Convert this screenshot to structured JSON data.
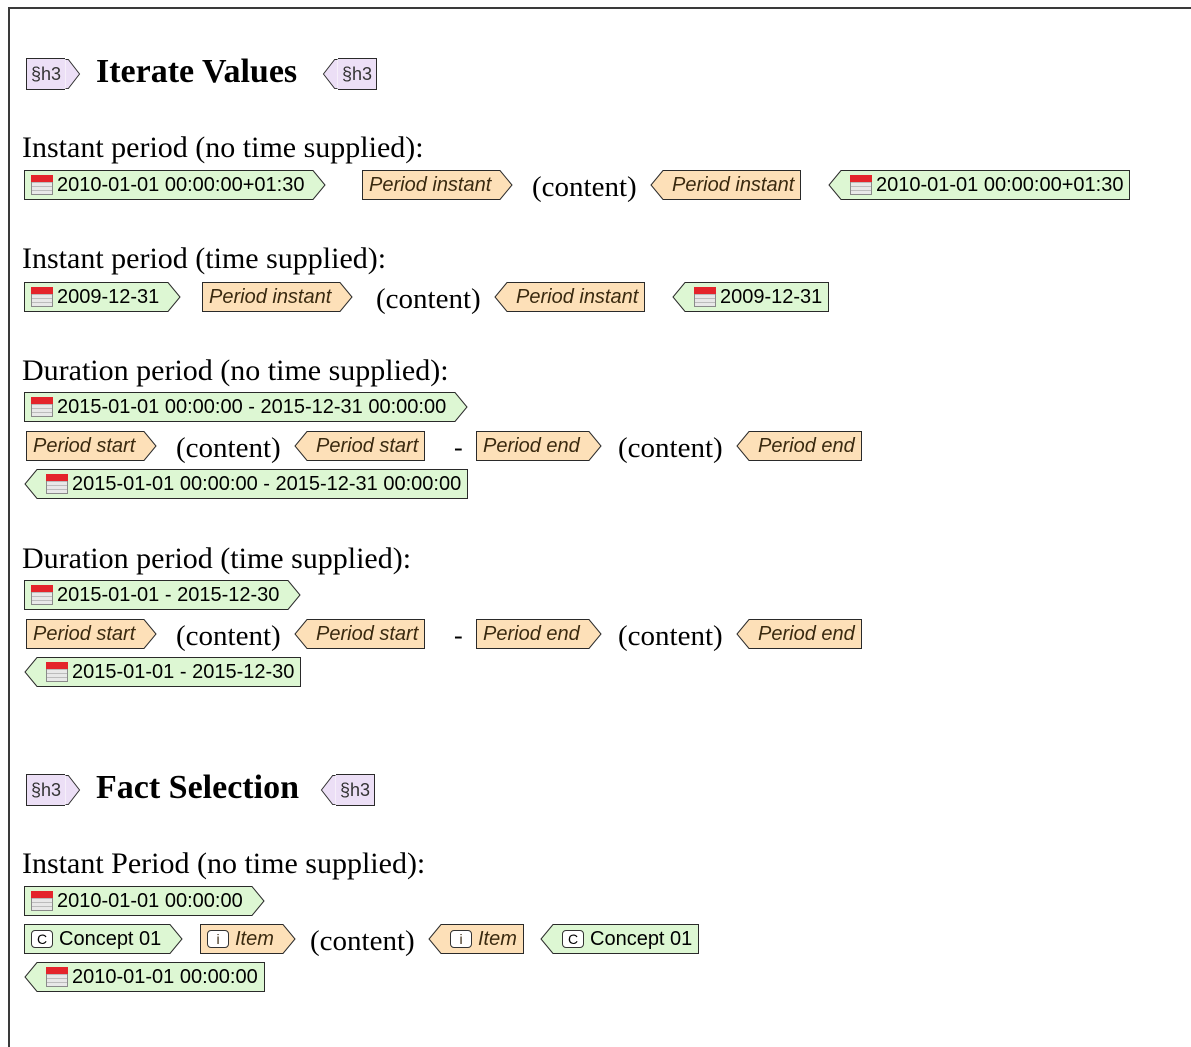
{
  "tag_h3": "§h3",
  "section1": {
    "title": "Iterate Values",
    "instant_no_time": {
      "label": "Instant period (no time supplied):",
      "date": "2010-01-01 00:00:00+01:30",
      "period_tag": "Period instant",
      "content": "(content)"
    },
    "instant_time": {
      "label": "Instant period (time supplied):",
      "date": "2009-12-31",
      "period_tag": "Period instant",
      "content": "(content)"
    },
    "duration_no_time": {
      "label": "Duration period (no time supplied):",
      "date": "2015-01-01 00:00:00 - 2015-12-31 00:00:00",
      "start_tag": "Period start",
      "end_tag": "Period end",
      "content": "(content)",
      "dash": "-"
    },
    "duration_time": {
      "label": "Duration period (time supplied):",
      "date": "2015-01-01 - 2015-12-30",
      "start_tag": "Period start",
      "end_tag": "Period end",
      "content": "(content)",
      "dash": "-"
    }
  },
  "section2": {
    "title": "Fact Selection",
    "instant_no_time": {
      "label": "Instant Period (no time supplied):",
      "date": "2010-01-01 00:00:00",
      "concept": "Concept 01",
      "item": "Item",
      "content": "(content)",
      "concept_icon": "C",
      "item_icon": "i"
    }
  },
  "colors": {
    "green_tag": "#ddf7d3",
    "orange_tag": "#fde0b8",
    "purple_tag": "#ecdff6",
    "calendar_red": "#e4242b"
  }
}
